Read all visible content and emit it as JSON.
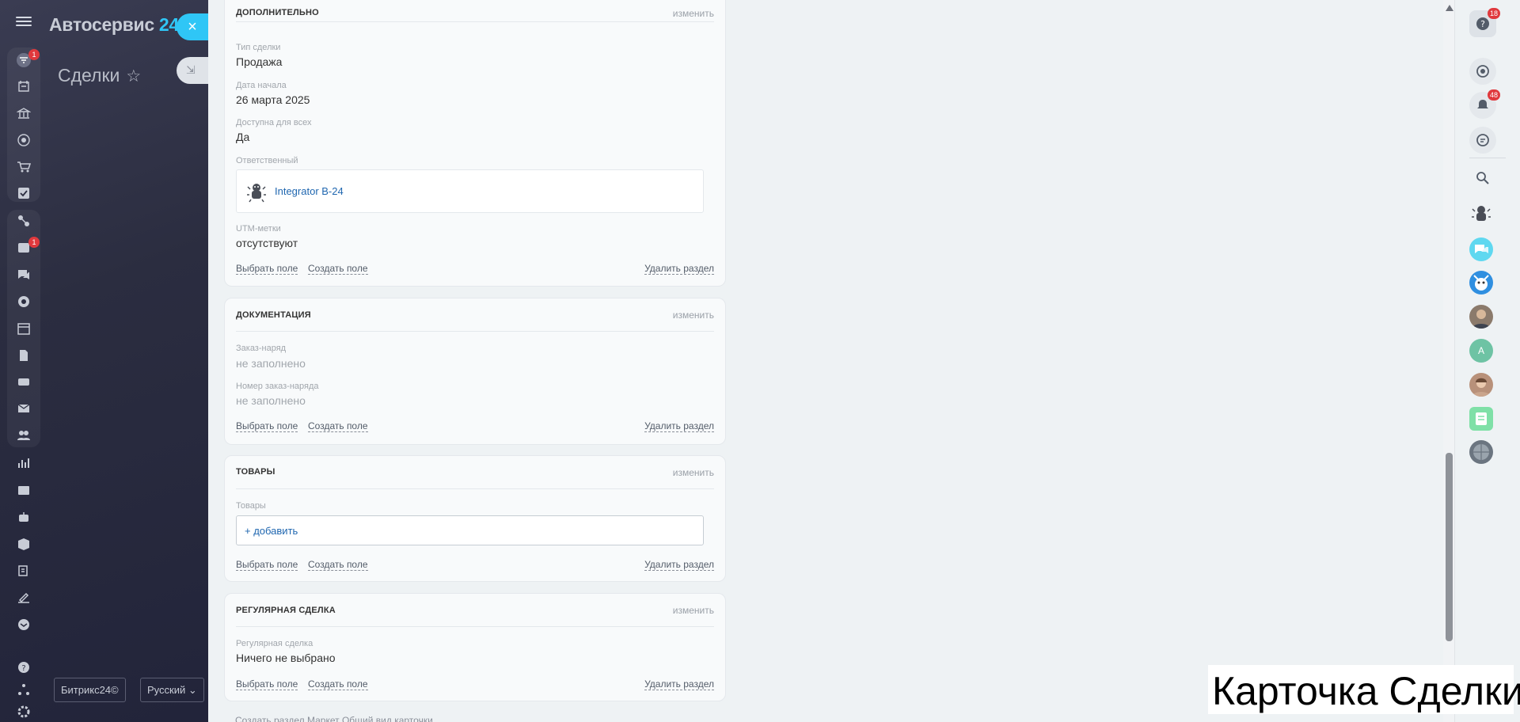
{
  "portal": {
    "logo_name": "Автосервис",
    "logo_num": "24",
    "page_title": "Сделки",
    "bitrix_btn": "Битрикс24©",
    "lang_btn": "Русский",
    "badge_filter": "1",
    "badge_inbox": "1"
  },
  "close_label": "×",
  "sections": {
    "additional": {
      "title": "дополнительно",
      "edit": "изменить",
      "deal_type_label": "Тип сделки",
      "deal_type_value": "Продажа",
      "start_label": "Дата начала",
      "start_value": "26 марта 2025",
      "available_label": "Доступна для всех",
      "available_value": "Да",
      "responsible_label": "Ответственный",
      "responsible_value": "Integrator B-24",
      "utm_label": "UTM-метки",
      "utm_value": "отсутствуют"
    },
    "documents": {
      "title": "документация",
      "edit": "изменить",
      "order_label": "Заказ-наряд",
      "order_value": "не заполнено",
      "order_num_label": "Номер заказ-наряда",
      "order_num_value": "не заполнено"
    },
    "products": {
      "title": "товары",
      "edit": "изменить",
      "products_label": "Товары",
      "add_label": "+ добавить"
    },
    "recurring": {
      "title": "регулярная сделка",
      "edit": "изменить",
      "recurring_label": "Регулярная сделка",
      "recurring_value": "Ничего не выбрано"
    }
  },
  "footer_links": {
    "select_field": "Выбрать поле",
    "create_field": "Создать поле",
    "delete_section": "Удалить раздел"
  },
  "bottom_strip": "Создать раздел    Маркет    Общий вид карточки",
  "right_rail": {
    "help_badge": "18",
    "notify_badge": "48",
    "avatar_a": "A"
  },
  "caption": "Карточка Сделки",
  "colors": {
    "accent": "#2fc6f6",
    "link": "#2067b0",
    "badge": "#e0393d"
  }
}
